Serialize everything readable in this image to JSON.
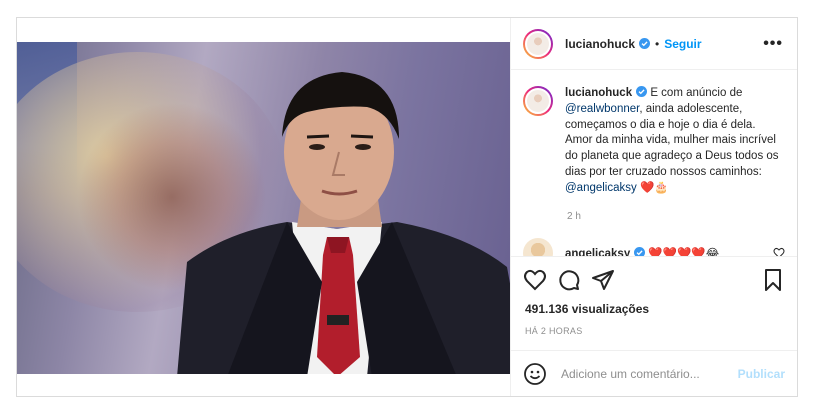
{
  "post": {
    "username": "lucianohuck",
    "follow_label": "Seguir",
    "more_label": "•••",
    "caption_intro": "E com anúncio de ",
    "caption_mention": "@realwbonner",
    "caption_body": ", ainda adolescente, começamos o dia e hoje o dia é dela. Amor da minha vida, mulher mais incrível do planeta que agradeço a Deus todos os dias por ter cruzado nossos caminhos: ",
    "caption_mention2": "@angelicaksy",
    "caption_emoji": " ❤️🎂",
    "caption_time": "2 h",
    "views": "491.136 visualizações",
    "posted_ago": "HÁ 2 HORAS"
  },
  "reply": {
    "username": "angelicaksy",
    "text": "❤️❤️❤️❤️😂"
  },
  "comment_box": {
    "placeholder": "Adicione um comentário...",
    "publish_label": "Publicar"
  },
  "colors": {
    "accent": "#0095f6",
    "verified": "#3897f0",
    "publish_disabled": "#b2dffc"
  }
}
